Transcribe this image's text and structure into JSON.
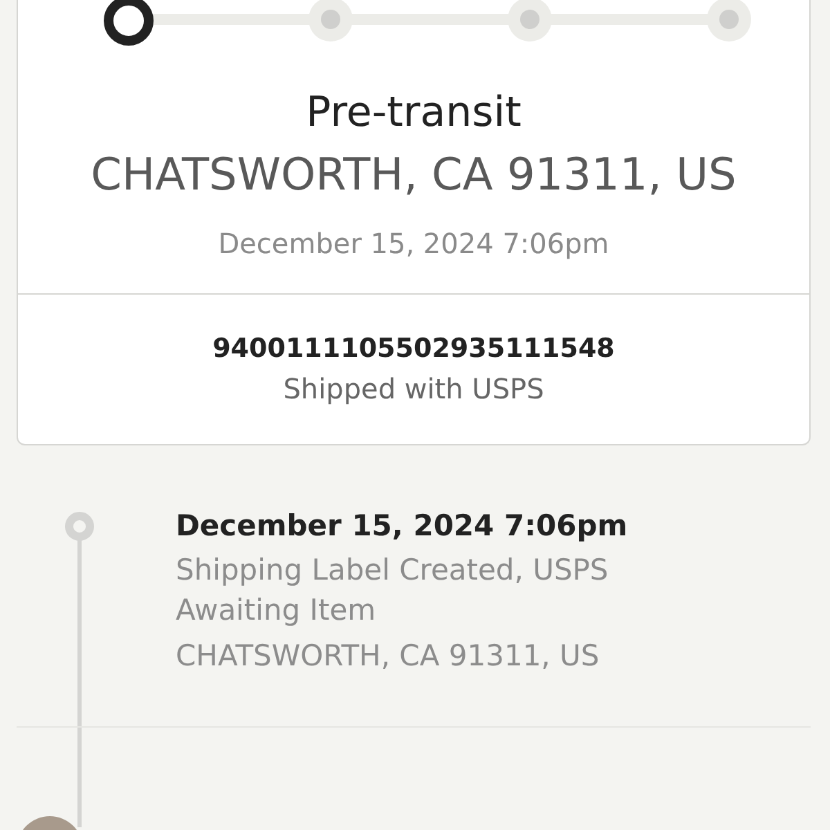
{
  "progress_steps": [
    {
      "active": true
    },
    {
      "active": false
    },
    {
      "active": false
    },
    {
      "active": false
    }
  ],
  "status": {
    "title": "Pre-transit",
    "location": "CHATSWORTH, CA 91311, US",
    "time": "December 15, 2024 7:06pm"
  },
  "shipment": {
    "tracking_number": "9400111105502935111548",
    "carrier": "Shipped with USPS"
  },
  "events": [
    {
      "date": "December 15, 2024 7:06pm",
      "description": "Shipping Label Created, USPS Awaiting Item",
      "location": "CHATSWORTH, CA 91311, US"
    }
  ],
  "next_event": {
    "kind": "avatar"
  }
}
